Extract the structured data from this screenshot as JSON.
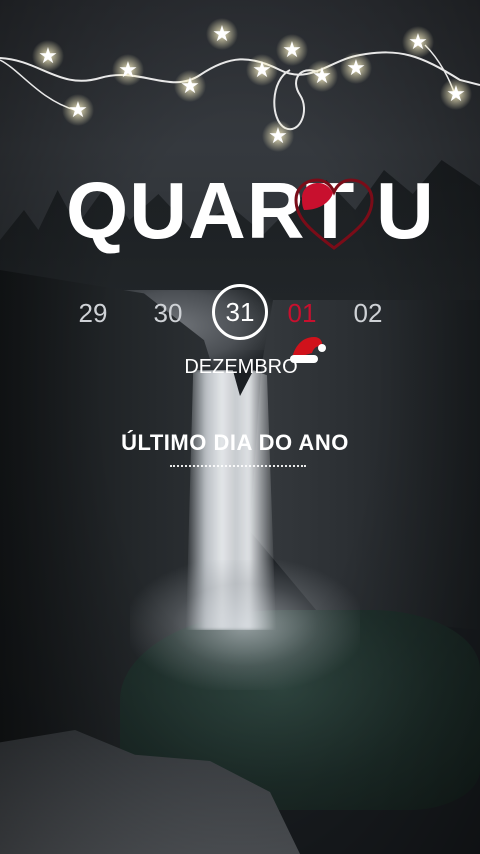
{
  "brand": {
    "left_text": "QUART",
    "right_text": "U",
    "heart_icon": "heart-icon",
    "heart_color": "#c8102e"
  },
  "calendar": {
    "dates": [
      {
        "label": "29",
        "state": "past"
      },
      {
        "label": "30",
        "state": "past"
      },
      {
        "label": "31",
        "state": "today"
      },
      {
        "label": "01",
        "state": "next-year"
      },
      {
        "label": "02",
        "state": "future"
      }
    ],
    "month": "DEZEMBRO",
    "month_icon": "santa-hat-icon"
  },
  "caption": {
    "text": "ÚLTIMO DIA DO ANO"
  },
  "decorations": {
    "string_lights_icon": "string-lights-icon"
  },
  "colors": {
    "accent_red": "#c8102e",
    "text": "#ffffff"
  }
}
